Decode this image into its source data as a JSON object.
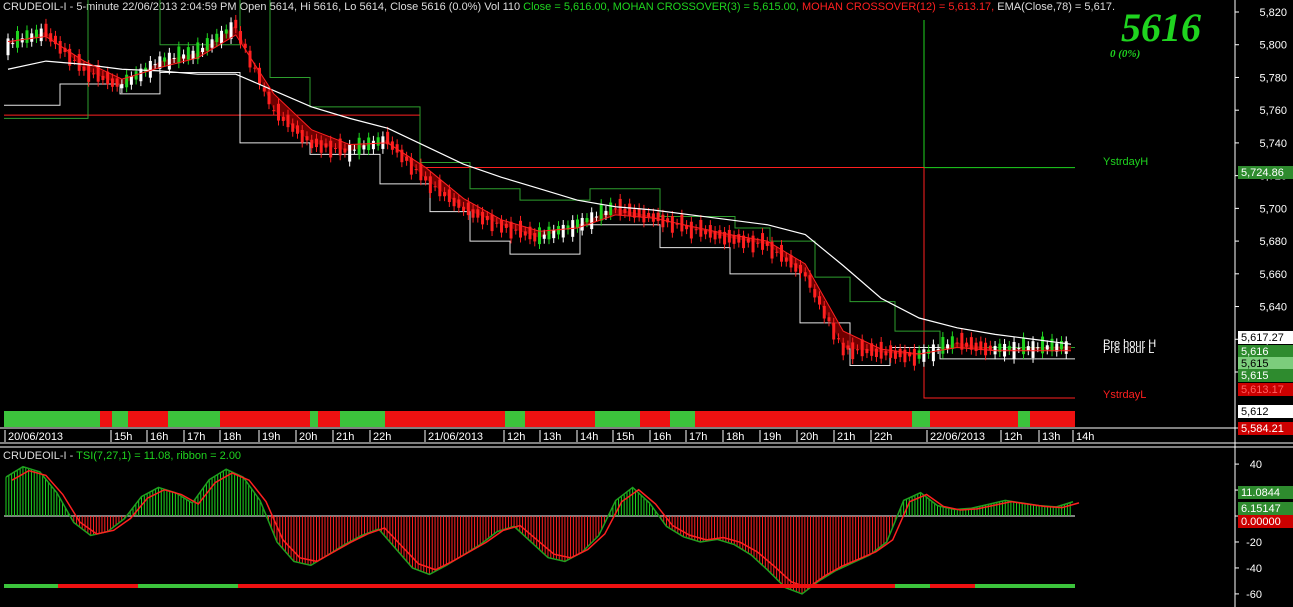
{
  "header": {
    "prefix": "CRUDEOIL-I - 5-minute 22/06/2013 2:04:59 PM Open 5614, Hi 5616, Lo 5614, Close 5616 (0.0%) Vol 110 ",
    "close_label": "Close = 5,616.00, ",
    "mc3_label": "MOHAN CROSSOVER(3) = 5,615.00, ",
    "mc12_label": "MOHAN CROSSOVER(12) = 5,613.17, ",
    "ema_label": "EMA(Close,78) = 5,617."
  },
  "big_price": "5616",
  "small_change": "0   (0%)",
  "annotations": {
    "ystrday_h": "YstrdayH",
    "ystrday_l": "YstrdayL",
    "pre_hour_h": "Pre hour H",
    "pre_hour_l": "Pre hour L"
  },
  "lower_header": {
    "prefix": "CRUDEOIL-I - ",
    "tsi_label": "TSI(7,27,1) = 11.08, ",
    "ribbon_label": "ribbon = 2.00"
  },
  "price_axis_ticks": [
    "5,820",
    "5,800",
    "5,780",
    "5,760",
    "5,740",
    "5,720",
    "5,700",
    "5,680",
    "5,660",
    "5,640",
    "5,620",
    "5,600"
  ],
  "price_tags": [
    {
      "label": "5,724.86",
      "bg": "#2e8b2e",
      "fg": "#ffffff"
    },
    {
      "label": "5,617.27",
      "bg": "#ffffff",
      "fg": "#000000"
    },
    {
      "label": "5,616",
      "bg": "#2e8b2e",
      "fg": "#ffffff"
    },
    {
      "label": "5,615",
      "bg": "#7ccd7c",
      "fg": "#000000"
    },
    {
      "label": "5,615",
      "bg": "#2e8b2e",
      "fg": "#ffffff"
    },
    {
      "label": "5,613.17",
      "bg": "#cc0000",
      "fg": "#ff6060"
    },
    {
      "label": "5,612",
      "bg": "#ffffff",
      "fg": "#000000"
    },
    {
      "label": "5,584.21",
      "bg": "#cc0000",
      "fg": "#ffffff"
    }
  ],
  "time_axis_labels": [
    "20/06/2013",
    "15h",
    "16h",
    "17h",
    "18h",
    "19h",
    "20h",
    "21h",
    "22h",
    "21/06/2013",
    "12h",
    "13h",
    "14h",
    "15h",
    "16h",
    "17h",
    "18h",
    "19h",
    "20h",
    "21h",
    "22h",
    "22/06/2013",
    "12h",
    "13h",
    "14h"
  ],
  "tsi_axis_ticks": [
    "40",
    "20",
    "0",
    "-20",
    "-40",
    "-60"
  ],
  "tsi_tags": [
    {
      "label": "11.0844",
      "bg": "#2e8b2e",
      "fg": "#ffffff"
    },
    {
      "label": "6.15147",
      "bg": "#2e8b2e",
      "fg": "#ffffff"
    },
    {
      "label": "0.00000",
      "bg": "#cc0000",
      "fg": "#ffffff"
    }
  ],
  "colors": {
    "bull": "#1fd41f",
    "bear": "#ff2020",
    "close_green": "#1fd41f",
    "mc3_green": "#1fd41f",
    "mc12_red": "#ff2020",
    "ema": "#ffffff",
    "grid": "#ffffff",
    "ystrday_h": "#1fd41f",
    "ystrday_l": "#ff2020"
  },
  "chart_data": [
    {
      "type": "line",
      "title": "CRUDEOIL-I - 5-minute",
      "ylim": [
        5590,
        5825
      ],
      "x_labels": [
        "20/06/2013",
        "15h",
        "16h",
        "17h",
        "18h",
        "19h",
        "20h",
        "21h",
        "22h",
        "21/06/2013",
        "12h",
        "13h",
        "14h",
        "15h",
        "16h",
        "17h",
        "18h",
        "19h",
        "20h",
        "21h",
        "22h",
        "22/06/2013",
        "12h",
        "13h",
        "14h"
      ],
      "series": [
        {
          "name": "Close",
          "values": [
            5800,
            5808,
            5785,
            5775,
            5790,
            5795,
            5812,
            5760,
            5740,
            5735,
            5742,
            5718,
            5700,
            5690,
            5682,
            5690,
            5700,
            5695,
            5688,
            5682,
            5678,
            5660,
            5615,
            5612,
            5610,
            5618,
            5614,
            5615,
            5616
          ]
        },
        {
          "name": "EMA(Close,78)",
          "values": [
            5785,
            5790,
            5788,
            5785,
            5784,
            5782,
            5782,
            5772,
            5762,
            5755,
            5749,
            5738,
            5727,
            5719,
            5712,
            5705,
            5701,
            5699,
            5696,
            5693,
            5690,
            5684,
            5665,
            5645,
            5633,
            5627,
            5623,
            5620,
            5617
          ]
        },
        {
          "name": "MOHAN CROSSOVER(12)",
          "values": [
            5802,
            5805,
            5790,
            5779,
            5786,
            5792,
            5806,
            5770,
            5748,
            5739,
            5740,
            5725,
            5706,
            5693,
            5686,
            5688,
            5696,
            5694,
            5689,
            5684,
            5680,
            5666,
            5625,
            5614,
            5611,
            5615,
            5613,
            5613,
            5613
          ]
        }
      ],
      "levels": [
        {
          "name": "YstrdayH",
          "value": 5724.86
        },
        {
          "name": "YstrdayL",
          "value": 5584.21
        }
      ]
    },
    {
      "type": "bar",
      "title": "TSI(7,27,1)",
      "ylim": [
        -62,
        45
      ],
      "series": [
        {
          "name": "TSI",
          "values": [
            30,
            38,
            34,
            18,
            -5,
            -15,
            -12,
            -2,
            15,
            22,
            18,
            10,
            28,
            36,
            30,
            12,
            -20,
            -35,
            -38,
            -30,
            -22,
            -15,
            -10,
            -25,
            -40,
            -45,
            -38,
            -30,
            -22,
            -12,
            -8,
            -20,
            -32,
            -35,
            -28,
            -15,
            12,
            22,
            10,
            -8,
            -16,
            -20,
            -18,
            -22,
            -30,
            -42,
            -55,
            -60,
            -50,
            -42,
            -36,
            -30,
            -20,
            12,
            18,
            8,
            5,
            6,
            9,
            12,
            10,
            8,
            7,
            11
          ]
        }
      ],
      "latest": 11.0844,
      "signal": 6.15147,
      "ribbon": 2.0
    }
  ]
}
